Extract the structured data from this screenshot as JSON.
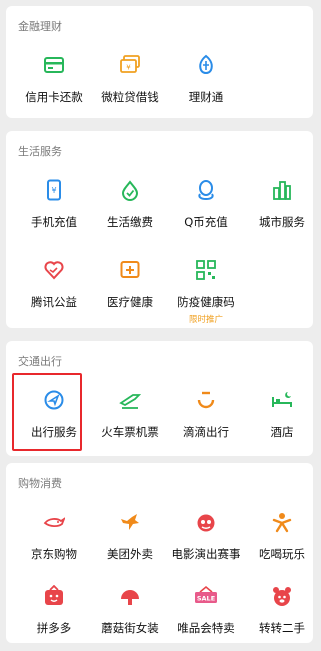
{
  "colors": {
    "green": "#27b75a",
    "orange": "#f08a1a",
    "red": "#e8454a",
    "blue": "#2a8ce8",
    "highlight": "#e8282c"
  },
  "sections": {
    "finance": {
      "title": "金融理财",
      "items": [
        {
          "label": "信用卡还款",
          "icon": "credit-card-icon"
        },
        {
          "label": "微粒贷借钱",
          "icon": "loan-icon"
        },
        {
          "label": "理财通",
          "icon": "wealth-icon"
        }
      ]
    },
    "life": {
      "title": "生活服务",
      "items": [
        {
          "label": "手机充值",
          "icon": "phone-recharge-icon"
        },
        {
          "label": "生活缴费",
          "icon": "utility-payment-icon"
        },
        {
          "label": "Q币充值",
          "icon": "qq-coin-icon"
        },
        {
          "label": "城市服务",
          "icon": "city-service-icon"
        },
        {
          "label": "腾讯公益",
          "icon": "charity-icon"
        },
        {
          "label": "医疗健康",
          "icon": "medical-icon"
        },
        {
          "label": "防疫健康码",
          "icon": "health-code-icon",
          "sub": "限时推广"
        }
      ]
    },
    "travel": {
      "title": "交通出行",
      "items": [
        {
          "label": "出行服务",
          "icon": "travel-service-icon"
        },
        {
          "label": "火车票机票",
          "icon": "train-ticket-icon"
        },
        {
          "label": "滴滴出行",
          "icon": "didi-icon"
        },
        {
          "label": "酒店",
          "icon": "hotel-icon"
        }
      ]
    },
    "shopping": {
      "title": "购物消费",
      "items": [
        {
          "label": "京东购物",
          "icon": "jd-icon"
        },
        {
          "label": "美团外卖",
          "icon": "meituan-icon"
        },
        {
          "label": "电影演出赛事",
          "icon": "movie-icon"
        },
        {
          "label": "吃喝玩乐",
          "icon": "entertainment-icon"
        },
        {
          "label": "拼多多",
          "icon": "pinduoduo-icon"
        },
        {
          "label": "蘑菇街女装",
          "icon": "mogujie-icon"
        },
        {
          "label": "唯品会特卖",
          "icon": "vip-sale-icon",
          "badge": "SALE"
        },
        {
          "label": "转转二手",
          "icon": "zhuanzhuan-icon"
        }
      ]
    }
  }
}
